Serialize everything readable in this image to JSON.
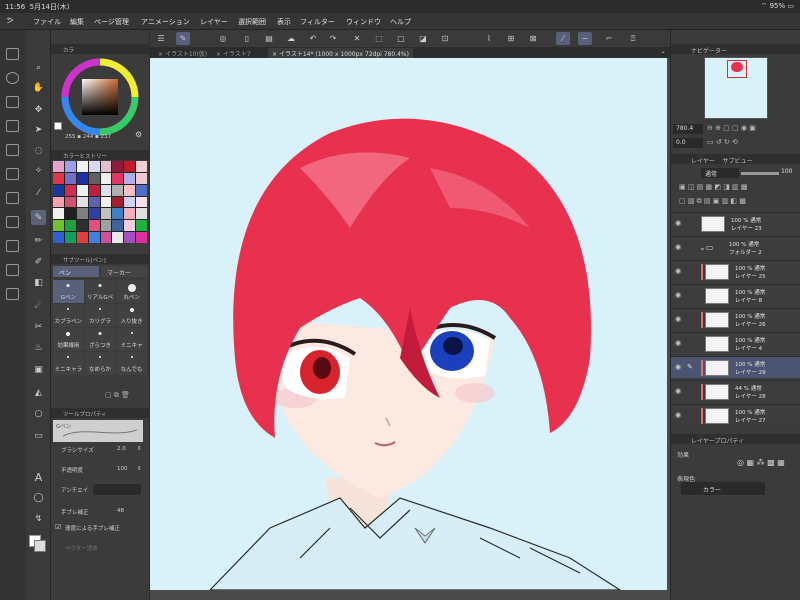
{
  "status": {
    "time": "11:56",
    "date": "5月14日(木)",
    "battery": "95%"
  },
  "menu": {
    "items": [
      "ファイル",
      "編集",
      "ページ管理",
      "アニメーション",
      "レイヤー",
      "選択範囲",
      "表示",
      "フィルター",
      "ウィンドウ",
      "ヘルプ"
    ]
  },
  "tabs": [
    {
      "label": "イラスト10(仮)"
    },
    {
      "label": "イラスト7"
    },
    {
      "label": "イラスト14* (1000 x 1000px 72dpi 780.4%)"
    }
  ],
  "color_panel": {
    "header": "カラ",
    "rgb": {
      "r": "255",
      "g": "244",
      "b": "237"
    },
    "history_title": "カラーヒストリー",
    "swatches": [
      "#e8a4c8",
      "#a0a0e8",
      "#f0f0f0",
      "#d8d8f0",
      "#e0c0d0",
      "#8c1c3c",
      "#c01c2c",
      "#f0d0d8",
      "#e03848",
      "#7070c8",
      "#2030a0",
      "#606060",
      "#f0f0f0",
      "#e03860",
      "#b0b0e8",
      "#f0c8d0",
      "#1838a0",
      "#d03050",
      "#f0f0f0",
      "#c02040",
      "#e0e0f0",
      "#b0b0b0",
      "#f8c0c0",
      "#5070c8",
      "#f8a0b0",
      "#d05070",
      "#e0e0e0",
      "#6060b0",
      "#f0f0f0",
      "#a02030",
      "#d0d0f0",
      "#f8e0e8",
      "#f0f0f0",
      "#202020",
      "#808080",
      "#3040a0",
      "#c0c0c0",
      "#4080c0",
      "#f0b0c0",
      "#e0e0e0",
      "#70c030",
      "#20a040",
      "#303030",
      "#e05080",
      "#a0a0a0",
      "#4060a0",
      "#f0d0e0",
      "#20b040",
      "#3060d0",
      "#10a060",
      "#e04040",
      "#4080e0",
      "#d050a0",
      "#e8e8e8",
      "#a050c0",
      "#e030a0"
    ]
  },
  "subtool": {
    "header": "サブツール[ペン]",
    "tab_pen": "ペン",
    "tab_marker": "マーカー",
    "brushes": [
      "Gペン",
      "リアルGペ",
      "丸ペン",
      "カブラペン",
      "カリグラ",
      "入り抜き",
      "効果線用",
      "ざらつき",
      "ミニキャ",
      "ミニキャラ",
      "なめらか",
      "なんでも"
    ]
  },
  "tool_property": {
    "header": "ツールプロパティ",
    "brush_name": "Gペン",
    "brush_size_label": "ブラシサイズ",
    "brush_size": "2.0",
    "opacity_label": "不透明度",
    "opacity": "100",
    "antialias_label": "アンチエイ",
    "stabilizer_label": "手ブレ補正",
    "stabilizer": "48",
    "speed_label": "速度による手ブレ補正",
    "vector_label": "ベクター消去"
  },
  "navigator": {
    "title": "ナビゲーター",
    "zoom": "780.4",
    "angle": "0.0"
  },
  "layer_panel": {
    "title": "レイヤー",
    "tab2": "サブビュー",
    "blend": "通常",
    "opacity": "100",
    "layers": [
      {
        "pct": "100 % 通常",
        "name": "レイヤー 23"
      },
      {
        "pct": "100 % 通常",
        "name": "フォルダー 2"
      },
      {
        "pct": "100 % 通常",
        "name": "レイヤー 25"
      },
      {
        "pct": "100 % 通常",
        "name": "レイヤー 8"
      },
      {
        "pct": "100 % 通常",
        "name": "レイヤー 26"
      },
      {
        "pct": "100 % 通常",
        "name": "レイヤー 4"
      },
      {
        "pct": "100 % 通常",
        "name": "レイヤー 29"
      },
      {
        "pct": "44 % 通常",
        "name": "レイヤー 28"
      },
      {
        "pct": "100 % 通常",
        "name": "レイヤー 27"
      }
    ]
  },
  "layer_property": {
    "title": "レイヤープロパティ",
    "effect_label": "効果",
    "expression_label": "表現色",
    "expression_value": "カラー"
  },
  "colors": {
    "accent": "#58607a",
    "canvas_bg": "#d9f2fa",
    "hair": "#e8304f"
  }
}
